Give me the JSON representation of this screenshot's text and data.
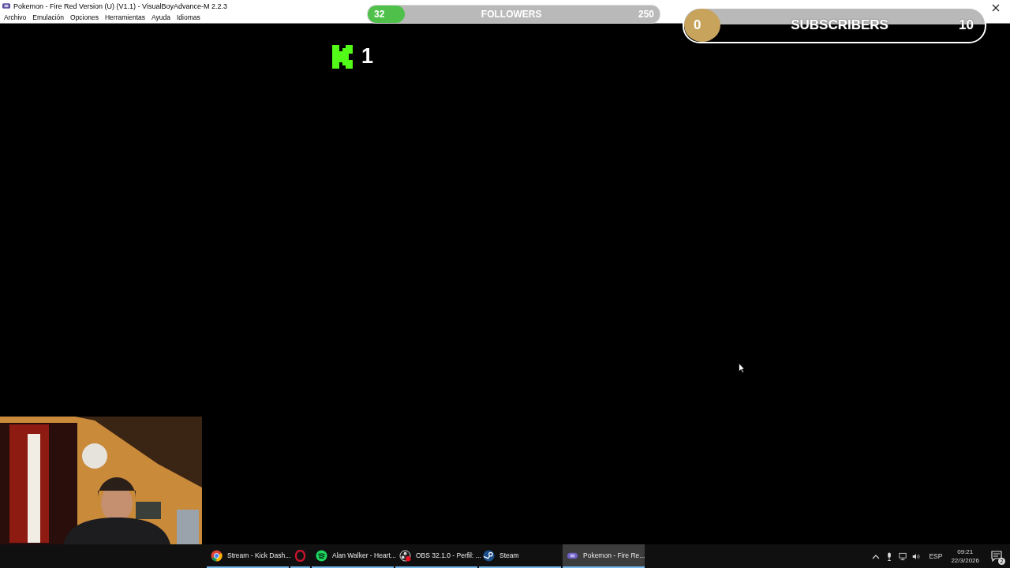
{
  "window": {
    "title": "Pokemon - Fire Red Version (U) (V1.1) - VisualBoyAdvance-M 2.2.3"
  },
  "menu": [
    "Archivo",
    "Emulación",
    "Opciones",
    "Herramientas",
    "Ayuda",
    "Idiomas"
  ],
  "followers_goal": {
    "current": "32",
    "label": "FOLLOWERS",
    "target": "250",
    "level": 0.128
  },
  "subscribers_goal": {
    "current": "0",
    "label": "SUBSCRIBERS",
    "target": "10",
    "level": 0
  },
  "viewer_count": {
    "value": "1"
  },
  "taskbar": {
    "apps": [
      {
        "label": "Stream - Kick Dash...",
        "selected": false
      },
      {
        "selected": false
      },
      {
        "label": "Alan Walker - Heart...",
        "selected": false
      },
      {
        "label": "OBS 32.1.0 - Perfil: ...",
        "selected": false
      },
      {
        "label": "Steam",
        "selected": false
      },
      {
        "label": "Pokemon - Fire Re...",
        "selected": true
      }
    ],
    "language": "ESP",
    "time": "09:21",
    "date": "22/3/2026",
    "notifications": "2"
  }
}
